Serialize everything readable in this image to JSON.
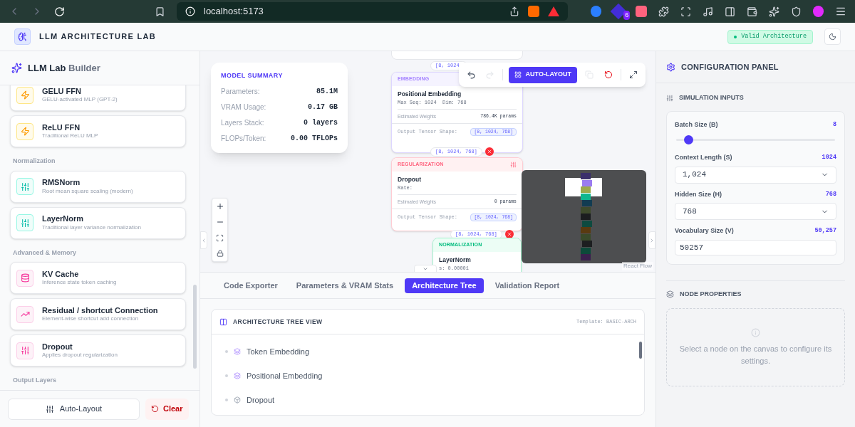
{
  "browser": {
    "url": "localhost:5173",
    "extension_badge": "6"
  },
  "header": {
    "title": "LLM ARCHITECTURE LAB",
    "status": {
      "label": "Valid Architecture",
      "valid": true
    }
  },
  "sidebar": {
    "title_bold": "LLM Lab",
    "title_rest": "Builder",
    "sections": [
      {
        "items": [
          {
            "kind": "ffn",
            "name": "GELU FFN",
            "desc": "GELU-activated MLP (GPT-2)"
          },
          {
            "kind": "ffn",
            "name": "ReLU FFN",
            "desc": "Traditional ReLU MLP"
          }
        ]
      },
      {
        "heading": "Normalization",
        "items": [
          {
            "kind": "norm",
            "name": "RMSNorm",
            "desc": "Root mean square scaling (modern)"
          },
          {
            "kind": "norm",
            "name": "LayerNorm",
            "desc": "Traditional layer variance normalization"
          }
        ]
      },
      {
        "heading": "Advanced & Memory",
        "items": [
          {
            "kind": "cache",
            "name": "KV Cache",
            "desc": "Inference state token caching"
          },
          {
            "kind": "residual",
            "name": "Residual / shortcut Connection",
            "desc": "Element-wise shortcut add connection"
          },
          {
            "kind": "dropout",
            "name": "Dropout",
            "desc": "Applies dropout regularization"
          }
        ]
      },
      {
        "heading": "Output Layers"
      }
    ],
    "buttons": {
      "auto_layout": "Auto-Layout",
      "clear": "Clear"
    }
  },
  "canvas": {
    "summary": {
      "title": "MODEL SUMMARY",
      "rows": [
        {
          "label": "Parameters:",
          "value": "85.1M"
        },
        {
          "label": "VRAM Usage:",
          "value": "0.17 GB"
        },
        {
          "label": "Layers Stack:",
          "value": "0 layers"
        },
        {
          "label": "FLOPs/Token:",
          "value": "0.00 TFLOPs"
        }
      ]
    },
    "toolbar": {
      "auto_layout": "AUTO-LAYOUT",
      "redo_disabled": true,
      "copy_disabled": true
    },
    "top_edge_label": "[8, 1024,",
    "nodes": [
      {
        "kind": "embedding",
        "category": "EMBEDDING",
        "name": "Positional Embedding",
        "detail": "Max Seq: 1024  Dim: 768",
        "weights_label": "Estimated Weights",
        "weights": "786.4K params",
        "shape_label": "Output Tensor Shape:",
        "shape": "[8, 1024, 768]",
        "edge_label": "[8, 1024, 768]"
      },
      {
        "kind": "regularization",
        "category": "REGULARIZATION",
        "name": "Dropout",
        "detail": "Rate:",
        "weights_label": "Estimated Weights",
        "weights": "0 params",
        "shape_label": "Output Tensor Shape:",
        "shape": "[8, 1024, 768]",
        "edge_label": "[8, 1024, 768]"
      },
      {
        "kind": "normalization",
        "category": "NORMALIZATION",
        "name": "LayerNorm",
        "detail": "s: 0.00001"
      }
    ],
    "attribution": "React Flow"
  },
  "tabs": [
    {
      "label": "Code Exporter",
      "selected": false
    },
    {
      "label": "Parameters & VRAM Stats",
      "selected": false
    },
    {
      "label": "Architecture Tree",
      "selected": true
    },
    {
      "label": "Validation Report",
      "selected": false
    }
  ],
  "tree": {
    "title": "ARCHITECTURE TREE VIEW",
    "template": "Template: BASIC-ARCH",
    "items": [
      {
        "kind": "layers",
        "label": "Token Embedding"
      },
      {
        "kind": "layers",
        "label": "Positional Embedding"
      },
      {
        "kind": "box",
        "label": "Dropout"
      }
    ]
  },
  "config": {
    "title": "CONFIGURATION PANEL",
    "inputs_title": "SIMULATION INPUTS",
    "fields": [
      {
        "kind": "slider",
        "label": "Batch Size (B)",
        "reading": "8",
        "level": 0.05
      },
      {
        "kind": "select",
        "label": "Context Length (S)",
        "reading": "1024",
        "value": "1,024"
      },
      {
        "kind": "select",
        "label": "Hidden Size (H)",
        "reading": "768",
        "value": "768"
      },
      {
        "kind": "input",
        "label": "Vocabulary Size (V)",
        "reading": "50,257",
        "value": "50257"
      }
    ],
    "node_title": "NODE PROPERTIES",
    "empty_message": "Select a node on the canvas to configure its settings."
  }
}
